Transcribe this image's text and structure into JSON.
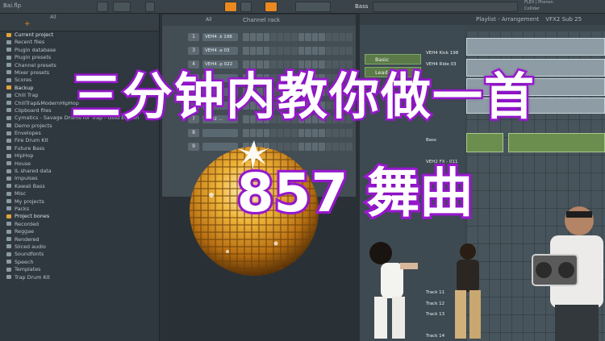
{
  "window": {
    "project_file": "Bai.flp",
    "sample_name": "Bass",
    "playlist_title": "Playlist - Arrangement",
    "playlist_sub": "VFX2 Sub 25",
    "plugin_label": "FLEX | Phonon",
    "preset_label": "Collider"
  },
  "browser": {
    "filter_label": "All",
    "items": [
      {
        "label": "Current project",
        "highlight": true
      },
      {
        "label": "Recent files",
        "highlight": false
      },
      {
        "label": "Plugin database",
        "highlight": false
      },
      {
        "label": "Plugin presets",
        "highlight": false
      },
      {
        "label": "Channel presets",
        "highlight": false
      },
      {
        "label": "Mixer presets",
        "highlight": false
      },
      {
        "label": "Scores",
        "highlight": false
      },
      {
        "label": "Backup",
        "highlight": true
      },
      {
        "label": "Chill Trap",
        "highlight": false
      },
      {
        "label": "ChillTrap&ModernHipHop",
        "highlight": false
      },
      {
        "label": "Clipboard files",
        "highlight": false
      },
      {
        "label": "Cymatics - Savage Drums for Trap - Gold Edition",
        "highlight": false
      },
      {
        "label": "Demo projects",
        "highlight": false
      },
      {
        "label": "Envelopes",
        "highlight": false
      },
      {
        "label": "Fire Drum Kit",
        "highlight": false
      },
      {
        "label": "Future Bass",
        "highlight": false
      },
      {
        "label": "HipHop",
        "highlight": false
      },
      {
        "label": "House",
        "highlight": false
      },
      {
        "label": "IL shared data",
        "highlight": false
      },
      {
        "label": "Impulses",
        "highlight": false
      },
      {
        "label": "Kawaii Bass",
        "highlight": false
      },
      {
        "label": "Misc",
        "highlight": false
      },
      {
        "label": "My projects",
        "highlight": false
      },
      {
        "label": "Packs",
        "highlight": false
      },
      {
        "label": "Project bones",
        "highlight": true
      },
      {
        "label": "Recorded",
        "highlight": false
      },
      {
        "label": "Reggae",
        "highlight": false
      },
      {
        "label": "Rendered",
        "highlight": false
      },
      {
        "label": "Sliced audio",
        "highlight": false
      },
      {
        "label": "Soundfonts",
        "highlight": false
      },
      {
        "label": "Speech",
        "highlight": false
      },
      {
        "label": "Templates",
        "highlight": false
      },
      {
        "label": "Trap Drum Kit",
        "highlight": false
      }
    ]
  },
  "channel_rack": {
    "title": "Channel rack",
    "filter": "All",
    "channels": [
      {
        "num": "1",
        "name": "VEH4 .k 198"
      },
      {
        "num": "3",
        "name": "VEH4 .e 03"
      },
      {
        "num": "4",
        "name": "VEH4 .p 022"
      },
      {
        "num": "",
        "name": ""
      },
      {
        "num": "",
        "name": ""
      },
      {
        "num": "",
        "name": ""
      },
      {
        "num": "7",
        "name": "VEH2 ..."
      },
      {
        "num": "8",
        "name": ""
      },
      {
        "num": "9",
        "name": ""
      }
    ]
  },
  "playlist": {
    "patterns": [
      "Basic",
      "Lead"
    ],
    "tracks": [
      "VEH4 Kick 198",
      "VEH4 Ride 03",
      "",
      "",
      "",
      "",
      "",
      "",
      "Bass",
      "",
      "VEH2 FX - 011",
      "",
      "",
      "",
      "",
      "",
      "",
      "",
      "",
      "",
      "",
      "",
      "Track 11",
      "Track 12",
      "Track 13",
      "",
      "Track 14"
    ]
  },
  "overlay": {
    "headline_line1": "三分钟内教你做一首",
    "headline_line2": "857  舞曲",
    "headline_fill": "#ffffff",
    "headline_stroke": "#a21ad9",
    "disco_ball": "disco-ball-graphic"
  },
  "colors": {
    "accent": "#e9891f",
    "pattern_green": "#5b7a48",
    "bg": "#2a3136"
  }
}
